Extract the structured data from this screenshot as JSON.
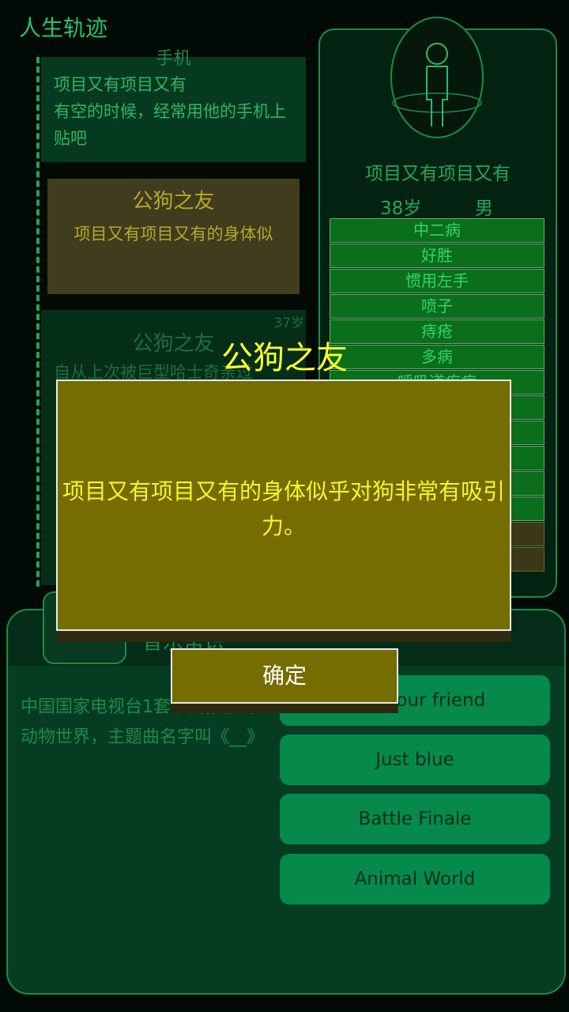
{
  "app": {
    "title": "人生轨迹"
  },
  "timeline": {
    "card1": {
      "header": "手机",
      "text": "项目又有项目又有\n有空的时候，经常用他的手机上贴吧"
    },
    "card2": {
      "title": "公狗之友",
      "text": "项目又有项目又有的身体似"
    },
    "card3": {
      "age": "37岁",
      "title": "公狗之友",
      "text": "自从上次被巨型哈士奇亲过"
    }
  },
  "profile": {
    "name": "项目又有项目又有",
    "age": "38岁",
    "gender": "男",
    "traits": [
      "中二病",
      "好胜",
      "惯用左手",
      "喷子",
      "痔疮",
      "多病",
      "呼吸道疾病",
      "",
      "",
      "",
      "",
      "",
      "",
      ""
    ],
    "trait_states": [
      "active",
      "active",
      "active",
      "active",
      "active",
      "active",
      "active",
      "active",
      "active",
      "active",
      "active",
      "active",
      "dim",
      "dim"
    ]
  },
  "question": {
    "title": "音乐常识",
    "text": "中国国家电视台1套节目播放的动物世界，主题曲名字叫《__》",
    "options": [
      "Dogs our friend",
      "Just blue",
      "Battle Finale",
      "Animal World"
    ]
  },
  "modal": {
    "title": "公狗之友",
    "message": "项目又有项目又有的身体似乎对狗非常有吸引力。",
    "confirm_label": "确定"
  },
  "colors": {
    "accent": "#1b8c4b",
    "modal_bg": "#756d00",
    "modal_text": "#f6f62f",
    "option_bg": "#058a4c"
  }
}
